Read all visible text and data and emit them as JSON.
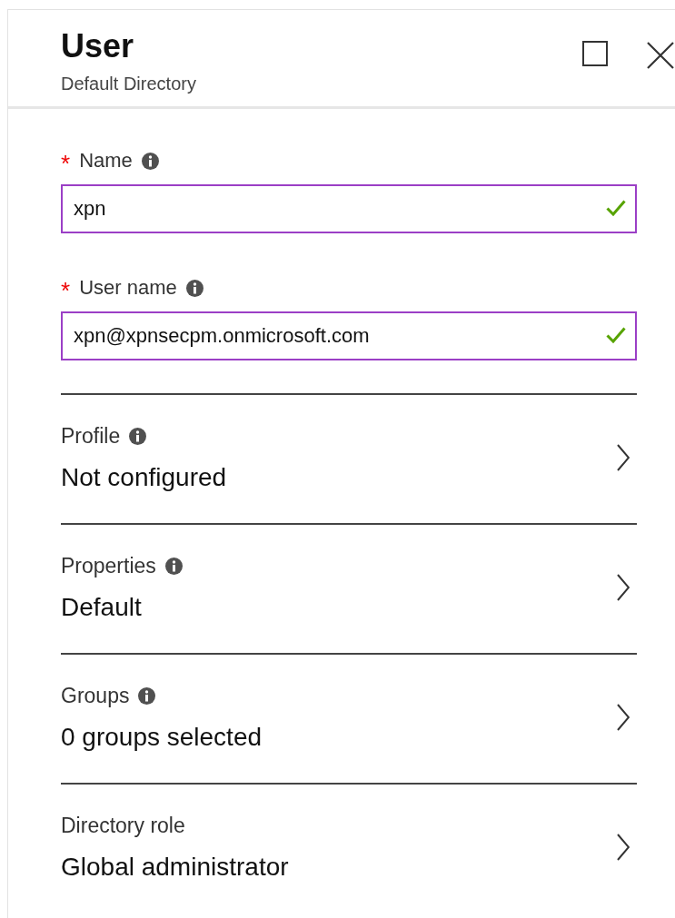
{
  "header": {
    "title": "User",
    "subtitle": "Default Directory"
  },
  "fields": [
    {
      "label": "Name",
      "required_mark": "*",
      "info": true,
      "value": "xpn",
      "valid": true
    },
    {
      "label": "User name",
      "required_mark": "*",
      "info": true,
      "value": "xpn@xpnsecpm.onmicrosoft.com",
      "valid": true
    }
  ],
  "sections": [
    {
      "label": "Profile",
      "info": true,
      "value": "Not configured"
    },
    {
      "label": "Properties",
      "info": true,
      "value": "Default"
    },
    {
      "label": "Groups",
      "info": true,
      "value": "0 groups selected"
    },
    {
      "label": "Directory role",
      "info": false,
      "value": "Global administrator"
    }
  ]
}
